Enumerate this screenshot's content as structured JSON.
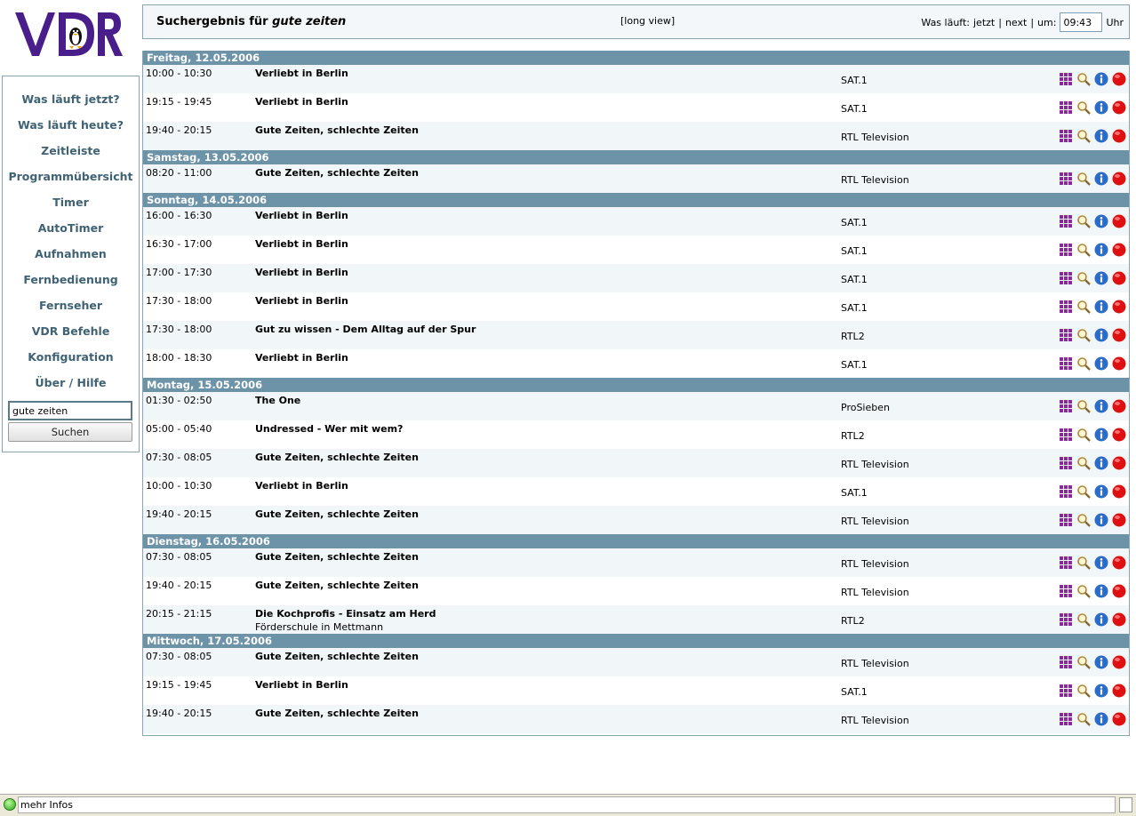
{
  "logo": {
    "text": "VDR"
  },
  "sidebar": {
    "nav": [
      "Was läuft jetzt?",
      "Was läuft heute?",
      "Zeitleiste",
      "Programmübersicht",
      "Timer",
      "AutoTimer",
      "Aufnahmen",
      "Fernbedienung",
      "Fernseher",
      "VDR Befehle",
      "Konfiguration",
      "Über / Hilfe"
    ],
    "search_value": "gute zeiten",
    "search_button": "Suchen"
  },
  "header": {
    "title_prefix": "Suchergebnis für",
    "title_query": "gute zeiten",
    "long_view": "[long view]",
    "was_laeuft": "Was läuft:",
    "jetzt": "jetzt",
    "sep1": "|",
    "next": "next",
    "sep2": "|",
    "um": "um:",
    "time_value": "09:43",
    "uhr": "Uhr"
  },
  "colors": {
    "day_header": "#6d93a8",
    "nav_text": "#3f6274",
    "row_alt": "#f1f6f9",
    "record": "#dd1111",
    "info": "#2b6cc8"
  },
  "icons": [
    "epg-grid-icon",
    "search-magnifier-icon",
    "info-icon",
    "record-icon"
  ],
  "days": [
    {
      "label": "Freitag, 12.05.2006",
      "rows": [
        {
          "time": "10:00 - 10:30",
          "title": "Verliebt in Berlin",
          "channel": "SAT.1"
        },
        {
          "time": "19:15 - 19:45",
          "title": "Verliebt in Berlin",
          "channel": "SAT.1"
        },
        {
          "time": "19:40 - 20:15",
          "title": "Gute Zeiten, schlechte Zeiten",
          "channel": "RTL Television"
        }
      ]
    },
    {
      "label": "Samstag, 13.05.2006",
      "rows": [
        {
          "time": "08:20 - 11:00",
          "title": "Gute Zeiten, schlechte Zeiten",
          "channel": "RTL Television"
        }
      ]
    },
    {
      "label": "Sonntag, 14.05.2006",
      "rows": [
        {
          "time": "16:00 - 16:30",
          "title": "Verliebt in Berlin",
          "channel": "SAT.1"
        },
        {
          "time": "16:30 - 17:00",
          "title": "Verliebt in Berlin",
          "channel": "SAT.1"
        },
        {
          "time": "17:00 - 17:30",
          "title": "Verliebt in Berlin",
          "channel": "SAT.1"
        },
        {
          "time": "17:30 - 18:00",
          "title": "Verliebt in Berlin",
          "channel": "SAT.1"
        },
        {
          "time": "17:30 - 18:00",
          "title": "Gut zu wissen - Dem Alltag auf der Spur",
          "channel": "RTL2"
        },
        {
          "time": "18:00 - 18:30",
          "title": "Verliebt in Berlin",
          "channel": "SAT.1"
        }
      ]
    },
    {
      "label": "Montag, 15.05.2006",
      "rows": [
        {
          "time": "01:30 - 02:50",
          "title": "The One",
          "channel": "ProSieben"
        },
        {
          "time": "05:00 - 05:40",
          "title": "Undressed - Wer mit wem?",
          "channel": "RTL2"
        },
        {
          "time": "07:30 - 08:05",
          "title": "Gute Zeiten, schlechte Zeiten",
          "channel": "RTL Television"
        },
        {
          "time": "10:00 - 10:30",
          "title": "Verliebt in Berlin",
          "channel": "SAT.1"
        },
        {
          "time": "19:40 - 20:15",
          "title": "Gute Zeiten, schlechte Zeiten",
          "channel": "RTL Television"
        }
      ]
    },
    {
      "label": "Dienstag, 16.05.2006",
      "rows": [
        {
          "time": "07:30 - 08:05",
          "title": "Gute Zeiten, schlechte Zeiten",
          "channel": "RTL Television"
        },
        {
          "time": "19:40 - 20:15",
          "title": "Gute Zeiten, schlechte Zeiten",
          "channel": "RTL Television"
        },
        {
          "time": "20:15 - 21:15",
          "title": "Die Kochprofis - Einsatz am Herd",
          "subtitle": "Förderschule in Mettmann",
          "channel": "RTL2"
        }
      ]
    },
    {
      "label": "Mittwoch, 17.05.2006",
      "rows": [
        {
          "time": "07:30 - 08:05",
          "title": "Gute Zeiten, schlechte Zeiten",
          "channel": "RTL Television"
        },
        {
          "time": "19:15 - 19:45",
          "title": "Verliebt in Berlin",
          "channel": "SAT.1"
        },
        {
          "time": "19:40 - 20:15",
          "title": "Gute Zeiten, schlechte Zeiten",
          "channel": "RTL Television"
        }
      ]
    }
  ],
  "statusbar": {
    "text": "mehr Infos"
  }
}
